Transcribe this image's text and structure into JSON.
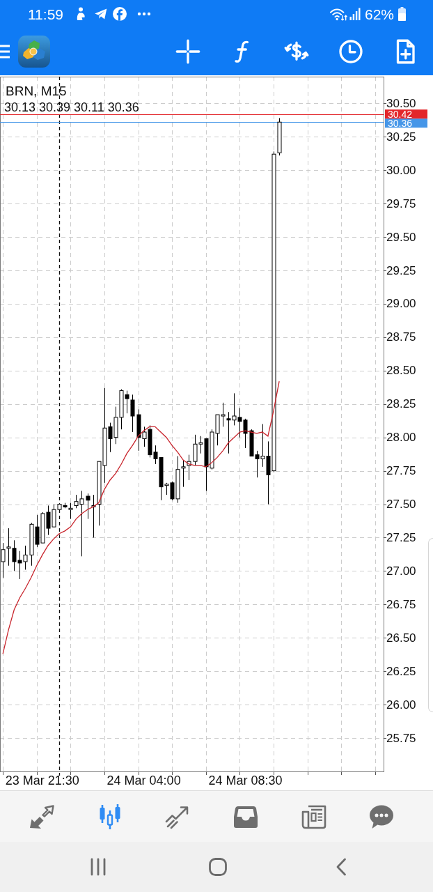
{
  "status_bar": {
    "time": "11:59",
    "battery": "62%"
  },
  "chart": {
    "ohlc_readout": "30.13 30.39 30.11 30.36",
    "chart_data": {
      "type": "candlestick",
      "title": "BRN, M15",
      "grid": true,
      "categories": [
        null,
        null,
        null,
        null,
        null,
        null,
        null,
        "23 Mar 21:30",
        null,
        null,
        null,
        null,
        null,
        null,
        null,
        null,
        null,
        null,
        null,
        null,
        null,
        null,
        null,
        null,
        null,
        "24 Mar 04:00",
        null,
        null,
        null,
        null,
        null,
        null,
        null,
        null,
        null,
        null,
        null,
        null,
        null,
        null,
        null,
        null,
        null,
        "24 Mar 08:30",
        null,
        null,
        null,
        null,
        null,
        null,
        null,
        null,
        null,
        null,
        null,
        null,
        null,
        null,
        null,
        null,
        null,
        null,
        null,
        null,
        null,
        null,
        null,
        null
      ],
      "ylim": [
        25.5,
        30.7
      ],
      "yticks": [
        {
          "value": 30.5,
          "label": "30.50"
        },
        {
          "value": 30.25,
          "label": "30.25"
        },
        {
          "value": 30,
          "label": "30.00"
        },
        {
          "value": 29.75,
          "label": "29.75"
        },
        {
          "value": 29.5,
          "label": "29.50"
        },
        {
          "value": 29.25,
          "label": "29.25"
        },
        {
          "value": 29,
          "label": "29.00"
        },
        {
          "value": 28.75,
          "label": "28.75"
        },
        {
          "value": 28.5,
          "label": "28.50"
        },
        {
          "value": 28.25,
          "label": "28.25"
        },
        {
          "value": 28,
          "label": "28.00"
        },
        {
          "value": 27.75,
          "label": "27.75"
        },
        {
          "value": 27.5,
          "label": "27.50"
        },
        {
          "value": 27.25,
          "label": "27.25"
        },
        {
          "value": 27,
          "label": "27.00"
        },
        {
          "value": 26.75,
          "label": "26.75"
        },
        {
          "value": 26.5,
          "label": "26.50"
        },
        {
          "value": 26.25,
          "label": "26.25"
        },
        {
          "value": 26,
          "label": "26.00"
        },
        {
          "value": 25.75,
          "label": "25.75"
        }
      ],
      "series": [
        {
          "ohlc": [
            [
              27.07,
              27.21,
              26.95,
              27.16
            ],
            [
              27.17,
              27.32,
              27.04,
              27.18
            ],
            [
              27.17,
              27.23,
              27.0,
              27.07
            ],
            [
              27.08,
              27.15,
              26.94,
              27.06
            ],
            [
              27.07,
              27.19,
              27.01,
              27.12
            ],
            [
              27.12,
              27.36,
              27.04,
              27.35
            ],
            [
              27.33,
              27.42,
              27.18,
              27.2
            ],
            [
              27.21,
              27.44,
              27.21,
              27.43
            ],
            [
              27.44,
              27.49,
              27.27,
              27.32
            ],
            [
              27.33,
              27.5,
              27.33,
              27.46
            ],
            [
              27.46,
              27.5,
              27.45,
              27.5
            ],
            [
              27.49,
              27.51,
              27.47,
              27.48
            ],
            [
              27.46,
              27.51,
              27.39,
              27.47
            ],
            [
              27.49,
              27.57,
              27.47,
              27.52
            ],
            [
              27.5,
              27.6,
              27.11,
              27.54
            ],
            [
              27.56,
              27.58,
              27.39,
              27.53
            ],
            [
              27.48,
              27.57,
              27.25,
              27.49
            ],
            [
              27.5,
              27.82,
              27.34,
              27.82
            ],
            [
              27.79,
              28.37,
              27.66,
              28.07
            ],
            [
              28.08,
              28.11,
              27.89,
              27.99
            ],
            [
              28.0,
              28.23,
              27.95,
              28.15
            ],
            [
              28.15,
              28.36,
              28.06,
              28.35
            ],
            [
              28.32,
              28.35,
              28.18,
              28.29
            ],
            [
              28.28,
              28.32,
              28.04,
              28.16
            ],
            [
              28.17,
              28.21,
              27.9,
              28.0
            ],
            [
              27.99,
              28.08,
              27.93,
              28.04
            ],
            [
              28.06,
              28.09,
              27.85,
              27.87
            ],
            [
              27.89,
              27.94,
              27.8,
              27.84
            ],
            [
              27.85,
              27.85,
              27.53,
              27.63
            ],
            [
              27.64,
              27.66,
              27.57,
              27.65
            ],
            [
              27.66,
              27.67,
              27.53,
              27.54
            ],
            [
              27.54,
              27.86,
              27.51,
              27.76
            ],
            [
              27.77,
              27.83,
              27.63,
              27.78
            ],
            [
              27.79,
              27.87,
              27.68,
              27.82
            ],
            [
              27.82,
              28.02,
              27.79,
              27.95
            ],
            [
              27.95,
              28.01,
              27.88,
              27.96
            ],
            [
              27.99,
              27.99,
              27.6,
              27.78
            ],
            [
              27.77,
              28.06,
              27.76,
              28.04
            ],
            [
              28.03,
              28.17,
              27.94,
              28.17
            ],
            [
              28.16,
              28.26,
              28.08,
              28.17
            ],
            [
              28.14,
              28.19,
              27.88,
              28.13
            ],
            [
              28.13,
              28.33,
              28.09,
              28.16
            ],
            [
              28.15,
              28.22,
              28.0,
              28.12
            ],
            [
              28.13,
              28.14,
              27.92,
              28.03
            ],
            [
              28.05,
              28.06,
              27.86,
              27.86
            ],
            [
              27.87,
              27.9,
              27.7,
              27.84
            ],
            [
              27.84,
              28.1,
              27.78,
              27.86
            ],
            [
              27.86,
              27.97,
              27.5,
              27.72
            ],
            [
              27.75,
              30.14,
              27.74,
              30.12
            ],
            [
              30.13,
              30.39,
              30.11,
              30.36
            ],
            null,
            null,
            null,
            null,
            null,
            null,
            null,
            null,
            null,
            null,
            null,
            null,
            null,
            null,
            null,
            null,
            null,
            null
          ]
        },
        {
          "type": "line",
          "color": "#c8242c",
          "values": [
            26.38,
            26.56,
            26.71,
            26.8,
            26.87,
            26.95,
            27.04,
            27.12,
            27.19,
            27.24,
            27.28,
            27.3,
            27.33,
            27.39,
            27.43,
            27.46,
            27.48,
            27.51,
            27.61,
            27.68,
            27.73,
            27.8,
            27.88,
            27.94,
            28.01,
            28.05,
            28.08,
            28.08,
            28.04,
            28.0,
            27.94,
            27.89,
            27.83,
            27.8,
            27.79,
            27.79,
            27.78,
            27.81,
            27.85,
            27.9,
            27.96,
            28.0,
            28.04,
            28.05,
            28.04,
            28.03,
            28.04,
            28.01,
            28.2,
            28.42,
            null,
            null,
            null,
            null,
            null,
            null,
            null,
            null,
            null,
            null,
            null,
            null,
            null,
            null,
            null,
            null,
            null,
            null
          ]
        }
      ],
      "ref_lines": [
        {
          "axis": "y",
          "value": 30.42,
          "label": "30.42",
          "color": "#e3262a"
        },
        {
          "axis": "y",
          "value": 30.36,
          "label": "30.36",
          "color": "#4596e8"
        }
      ]
    }
  },
  "bottom_tabs": [
    {
      "selected": false
    },
    {
      "selected": true
    },
    {
      "selected": false
    },
    {
      "selected": false
    },
    {
      "selected": false
    },
    {
      "selected": false
    }
  ]
}
